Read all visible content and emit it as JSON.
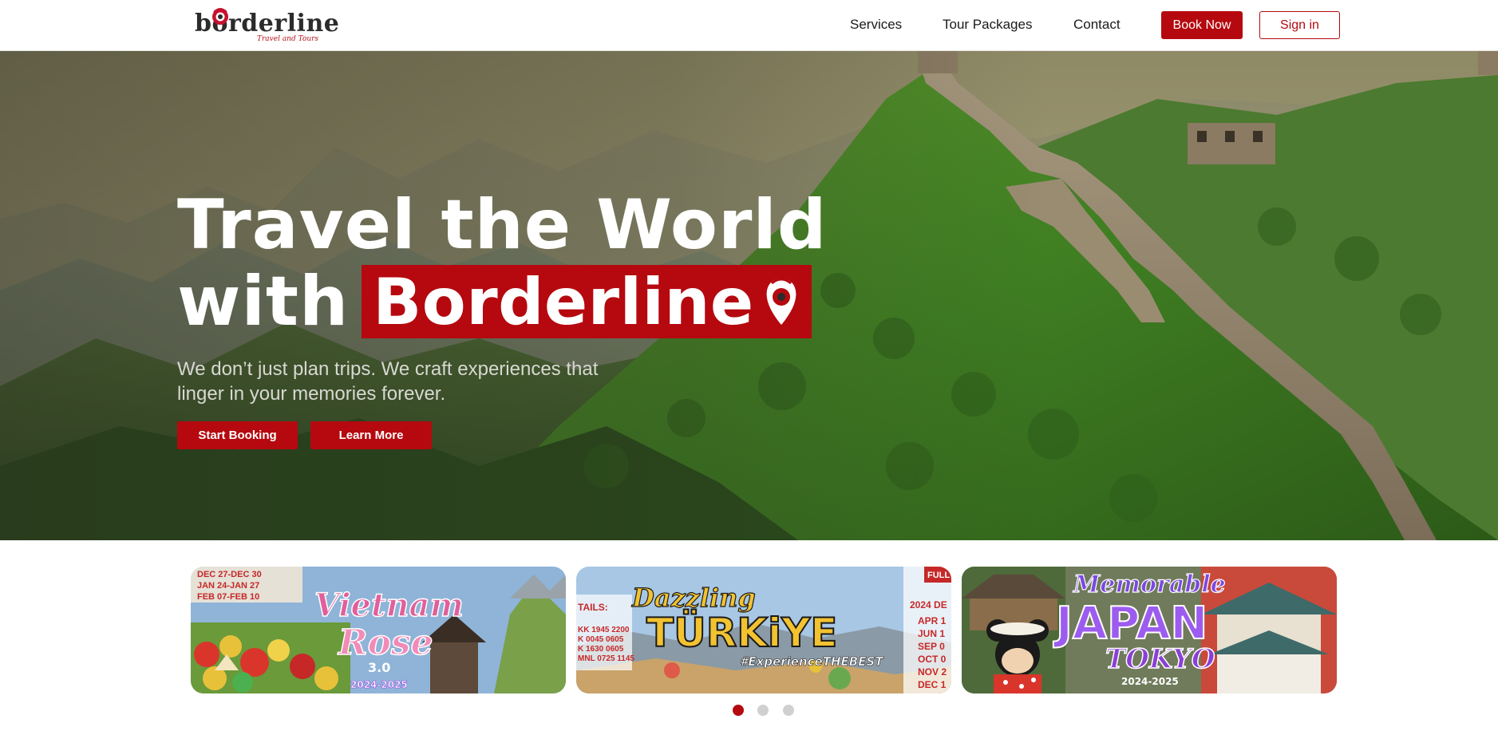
{
  "brand": {
    "logo_text": "borderline",
    "logo_tagline": "Travel and Tours",
    "accent_color": "#b5090f"
  },
  "nav": {
    "links": [
      "Services",
      "Tour Packages",
      "Contact"
    ],
    "book_label": "Book Now",
    "signin_label": "Sign in"
  },
  "hero": {
    "title_line1": "Travel the World",
    "title_with": "with",
    "title_brand": "Borderline",
    "subtitle": "We don’t just plan trips. We craft experiences that linger in your memories forever.",
    "cta_primary": "Start Booking",
    "cta_secondary": "Learn More"
  },
  "carousel": {
    "cards": [
      {
        "title": "Vietnam",
        "title2": "Rose",
        "version": "3.0",
        "years": "2024-2025",
        "dates": [
          "DEC 27-DEC 30",
          "JAN 24-JAN 27",
          "FEB 07-FEB 10"
        ]
      },
      {
        "title_a": "Dazzling",
        "title_b": "TÜRKiYE",
        "tagline": "#ExperienceTHEBEST",
        "badge": "FULL",
        "details_label": "TAILS:",
        "flights": [
          "KK 1945 2200",
          "K 0045 0605",
          "K 1630 0605",
          "MNL 0725 1145"
        ],
        "year_label": "2024 DE",
        "months": [
          "APR 1",
          "JUN 1",
          "SEP 0",
          "OCT 0",
          "NOV 2",
          "DEC 1"
        ]
      },
      {
        "title_a": "Memorable",
        "title_b": "JAPAN",
        "title_c": "TOKYO",
        "years": "2024-2025"
      }
    ],
    "active_index": 0,
    "dot_count": 3
  }
}
